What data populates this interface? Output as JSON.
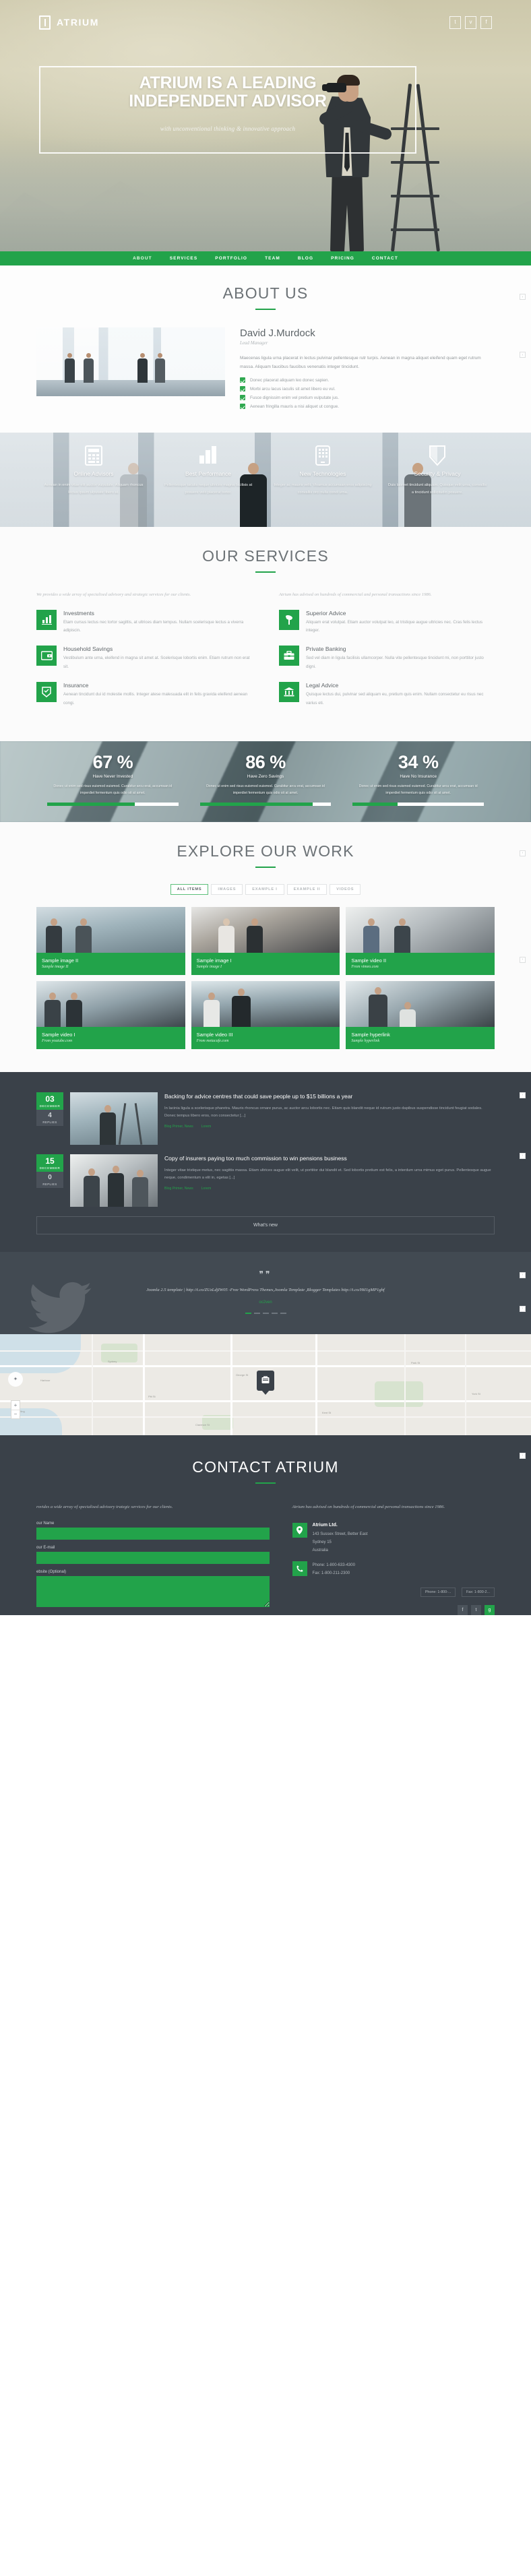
{
  "brand": {
    "name": "ATRIUM",
    "accent": "#22a34a",
    "dark": "#3a4149"
  },
  "hero": {
    "title_line1": "ATRIUM IS A LEADING",
    "title_line2": "INDEPENDENT ADVISOR",
    "subtitle": "with unconventional thinking & innovative approach",
    "social": [
      {
        "name": "twitter-icon",
        "glyph": "t"
      },
      {
        "name": "vimeo-icon",
        "glyph": "v"
      },
      {
        "name": "facebook-icon",
        "glyph": "f"
      }
    ]
  },
  "nav": {
    "items": [
      "ABOUT",
      "SERVICES",
      "PORTFOLIO",
      "TEAM",
      "BLOG",
      "PRICING",
      "CONTACT"
    ]
  },
  "about": {
    "title": "ABOUT US",
    "name": "David J.Murdock",
    "role": "Lead Manager",
    "paragraph": "Maecenas ligula urna placerat in lectus pulvinar pellentesque rutr turpis. Aenean in magna aliquet eleifend quam eget rutrum massa. Aliquam faucibus faucibus venenatis integer tincidunt.",
    "bullets": [
      "Donec placerat aliquam leo donec sapien.",
      "Morbi arcu lacus iaculis sit amet libero eu vul.",
      "Fusce dignissim enim vel pretium vulputate jus.",
      "Aenean fringilla mauris a nisi aliquet ut congue."
    ]
  },
  "features": [
    {
      "icon": "calculator-icon",
      "title": "Online Advisors",
      "text": "Aenean in enim vitae elit auctor vulputate. Aliquam rhoncus lectus ipsum ulputate libero at."
    },
    {
      "icon": "bar-chart-icon",
      "title": "Best Performance",
      "text": "Pellentesque iaculis neque ultrices magna facilisis at posuere velit placerat tortor."
    },
    {
      "icon": "tablet-icon",
      "title": "New Technologies",
      "text": "Integer ac mauris velit. Vivamus accumsan eros adipiscing convallis orci nulla condi urna."
    },
    {
      "icon": "shield-icon",
      "title": "Security & Privacy",
      "text": "Duis laoreet tincidunt aliquam. Quisque velit urna, convallis a tincidunt sollicitudin posuere."
    }
  ],
  "services": {
    "title": "OUR SERVICES",
    "intro_left": "We provides a wide array of specialised advisory and strategic services for our clients.",
    "intro_right": "Atrium has advised on hundreds of commercial and personal transactions since 1986.",
    "left_items": [
      {
        "icon": "bar-chart-icon",
        "title": "Investments",
        "text": "Etam cursus lectus nec tortor sagittis, at ultrices diam tempus. Nullam scelerisque lectus a viverra adipiscin."
      },
      {
        "icon": "wallet-icon",
        "title": "Household Savings",
        "text": "Vestibulum ante urna, eleifend in magna sit amet at. Scelerisque lobortis enim. Etiam rutrum non erat sit."
      },
      {
        "icon": "shield-icon",
        "title": "Insurance",
        "text": "Aenean tincidunt dui id molestie mollis. Integer atese malesuada elit in felis gravida eleifend aenean congi."
      }
    ],
    "right_items": [
      {
        "icon": "megaphone-icon",
        "title": "Superior Advice",
        "text": "Aliquam erat volutpat. Etiam auctor volutpat leo, at tristique augue ultricies nec. Cras felis lectus integer."
      },
      {
        "icon": "briefcase-icon",
        "title": "Private Banking",
        "text": "Sed vel diam in ligula facilisis ullamcorper. Nulla vite pellentesque tincidunt mi, non porttitor justo digni."
      },
      {
        "icon": "bank-icon",
        "title": "Legal Advice",
        "text": "Quisque lectus dui, pulvinar sed aliquam eu, pretium quis enim. Nullam consectetur eu risus nec varius eti."
      }
    ]
  },
  "stats": [
    {
      "value": "67 %",
      "label": "Have Never Invested",
      "percent": 67,
      "text": "Donec ut enim sed risus euismod euismod. Curabitur arcu erat, accumsan id imperdiet fermentum quis odio sit at amet."
    },
    {
      "value": "86 %",
      "label": "Have Zero Savings",
      "percent": 86,
      "text": "Donec ut enim sed risus euismod euismod. Curabitur arcu erat, accumsan id imperdiet fermentum quis odio sit at amet."
    },
    {
      "value": "34 %",
      "label": "Have No Insurance",
      "percent": 34,
      "text": "Donec ut enim sed risus euismod euismod. Curabitur arcu erat, accumsan id imperdiet fermentum quis odio sit at amet."
    }
  ],
  "portfolio": {
    "title": "EXPLORE OUR WORK",
    "filters": [
      "ALL ITEMS",
      "IMAGES",
      "EXAMPLE I",
      "EXAMPLE II",
      "VIDEOS"
    ],
    "active_filter": "ALL ITEMS",
    "items": [
      {
        "title": "Sample image II",
        "subtitle": "Sample image II"
      },
      {
        "title": "Sample image I",
        "subtitle": "Sample image I"
      },
      {
        "title": "Sample video II",
        "subtitle": "From vimeo.com"
      },
      {
        "title": "Sample video I",
        "subtitle": "From youtube.com"
      },
      {
        "title": "Sample video III",
        "subtitle": "From metacafe.com"
      },
      {
        "title": "Sample hyperlink",
        "subtitle": "Sample hyperlink"
      }
    ]
  },
  "blog": {
    "posts": [
      {
        "day": "03",
        "month": "DECEMBER",
        "replies": "4",
        "replies_label": "REPLIES",
        "title": "Backing for advice centres that could save people up to $15 billions a year",
        "text": "In lacinia ligula a scelerisque pharetra. Mauris rhoncus ornare purus, ac auctor arcu lobortis nec. Etiam quis blandit neque id rutrum justo dapibus suspendisse tincidunt feugiat sodales. Donec tempus libero eros, non consectetur [...]",
        "meta": [
          "Blog Primer, News",
          "Lorem"
        ]
      },
      {
        "day": "15",
        "month": "DECEMBER",
        "replies": "0",
        "replies_label": "REPLIES",
        "title": "Copy of insurers paying too much commission to win pensions business",
        "text": "Integer vitae tristique metus, nec sagittis massa. Etiam ultrices augue elit velit, ut porttitor dui blandit et. Sed lobortis pretium est felis, a interdum urna mimus eget purus. Pellentesque augue neque, condimentum a elit in, egetas [...]",
        "meta": [
          "Blog Primer, News",
          "Lorem"
        ]
      }
    ],
    "whats_new": "What's new"
  },
  "tweet": {
    "text": "Joomla 2.5 template  |  http://t.co/ZUzLdjIW05 -Free WordPress Themes,Joomla Template ,Blogger Templates http://t.co/HtI1gMP1gbf",
    "user": "oc2ven"
  },
  "map": {
    "labels": [
      "Sydney",
      "Pitt St",
      "George St",
      "Kent St",
      "Harbour",
      "Darling",
      "Park St",
      "York St",
      "Clarence St"
    ],
    "zoom_in": "+",
    "zoom_out": "−",
    "compass": "✦",
    "pin": "location-pin"
  },
  "contact": {
    "title": "CONTACT ATRIUM",
    "lead_left": "rovides a wide array of specialised advisory trategic services for our clients.",
    "lead_right": "Atrium has advised on hundreds of commercial and personal transactions since 1986.",
    "fields": [
      {
        "label": "our Name",
        "placeholder": ""
      },
      {
        "label": "our E-mail",
        "placeholder": ""
      },
      {
        "label": "ebsite (Optional)",
        "placeholder": ""
      }
    ],
    "address_title": "Atrium Ltd.",
    "address": "143 Sussex Street, Better East\nSydney 15\nAustralia",
    "phone": "Phone: 1-800-633-4300\nFax: 1-800-211-2300",
    "chips": [
      "Phone: 1-800-...",
      "Fax: 1-800-2..."
    ],
    "social": [
      {
        "name": "facebook-icon",
        "glyph": "f"
      },
      {
        "name": "twitter-icon",
        "glyph": "t"
      },
      {
        "name": "google-plus-icon",
        "glyph": "g"
      }
    ]
  }
}
